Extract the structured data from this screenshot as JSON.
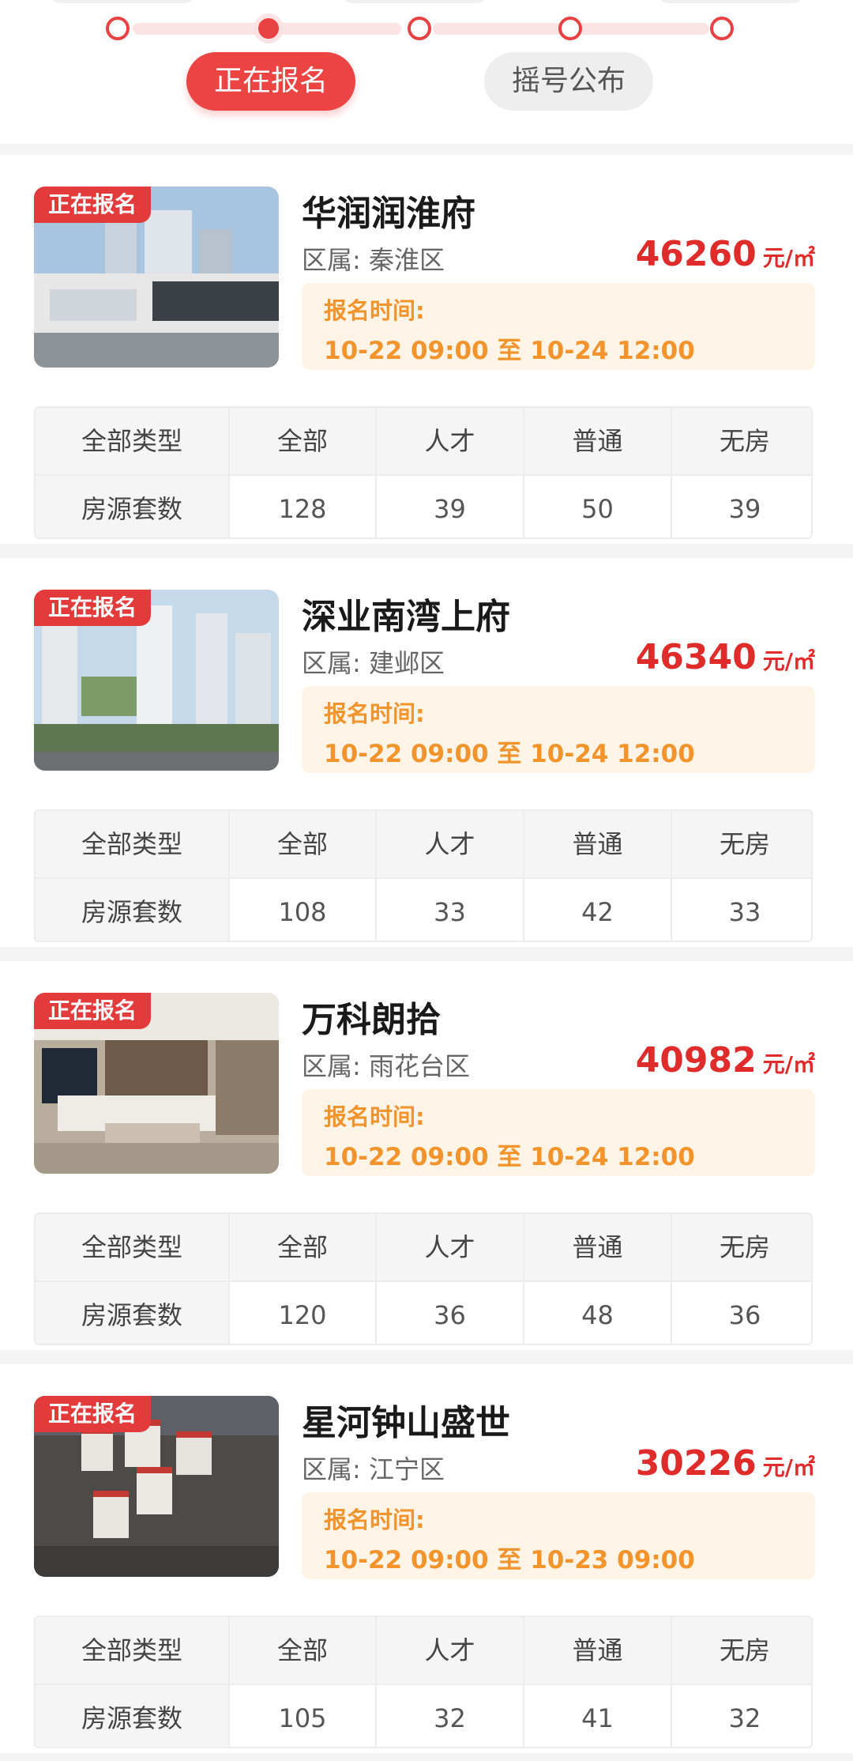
{
  "stepper": {
    "active_label": "正在报名",
    "next_label": "摇号公布"
  },
  "table_labels": {
    "type_header": "全部类型",
    "count_label": "房源套数",
    "col_all": "全部",
    "col_talent": "人才",
    "col_normal": "普通",
    "col_nohouse": "无房"
  },
  "badge_label": "正在报名",
  "district_prefix": "区属: ",
  "time_label": "报名时间:",
  "price_unit": "元/㎡",
  "colors": {
    "accent_red": "#e84141",
    "price_red": "#e02b2b",
    "time_orange": "#f3932b",
    "time_bg": "#fff4e6"
  },
  "projects": [
    {
      "name": "华润润淮府",
      "district": "秦淮区",
      "price": "46260",
      "time": "10-22 09:00 至 10-24 12:00",
      "counts": {
        "all": "128",
        "talent": "39",
        "normal": "50",
        "nohouse": "39"
      }
    },
    {
      "name": "深业南湾上府",
      "district": "建邺区",
      "price": "46340",
      "time": "10-22 09:00 至 10-24 12:00",
      "counts": {
        "all": "108",
        "talent": "33",
        "normal": "42",
        "nohouse": "33"
      }
    },
    {
      "name": "万科朗拾",
      "district": "雨花台区",
      "price": "40982",
      "time": "10-22 09:00 至 10-24 12:00",
      "counts": {
        "all": "120",
        "talent": "36",
        "normal": "48",
        "nohouse": "36"
      }
    },
    {
      "name": "星河钟山盛世",
      "district": "江宁区",
      "price": "30226",
      "time": "10-22 09:00 至 10-23 09:00",
      "counts": {
        "all": "105",
        "talent": "32",
        "normal": "41",
        "nohouse": "32"
      }
    }
  ]
}
